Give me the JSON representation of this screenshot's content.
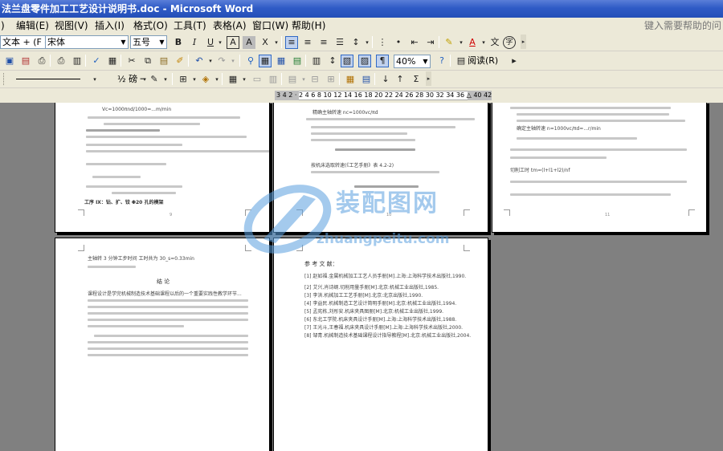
{
  "window": {
    "title": "法兰盘零件加工工艺设计说明书.doc - Microsoft Word"
  },
  "menubar": {
    "items": [
      "文件(F)",
      "编辑(E)",
      "视图(V)",
      "插入(I)",
      "格式(O)",
      "工具(T)",
      "表格(A)",
      "窗口(W)",
      "帮助(H)"
    ],
    "visible_items": [
      ")",
      "编辑(E)",
      "视图(V)",
      "插入(I)",
      "格式(O)",
      "工具(T)",
      "表格(A)",
      "窗口(W)",
      "帮助(H)"
    ],
    "help_placeholder": "键入需要帮助的问"
  },
  "formatting_toolbar": {
    "style_value": "文本 + (F -",
    "font_value": "宋体",
    "size_value": "五号",
    "bold_label": "B",
    "italic_label": "I",
    "underline_label": "U",
    "char_border_label": "A",
    "char_shading_label": "A",
    "scale_label": "X"
  },
  "standard_toolbar": {
    "zoom_value": "40%",
    "read_label": "阅读(R)"
  },
  "drawing_toolbar": {
    "style_label": "Σ"
  },
  "ruler": {
    "scale_text": "3 4 2 2 4 6 8 10 12 14 16 18 20 22 24 26 28 30 32 34 36 38 40 42",
    "visible_scale": "3 4 2 · 2 4 6 8 10 12 14 16 18 20 22 24 26 28 30 32 34 36 △ 40 42"
  },
  "document": {
    "pages": [
      {
        "id": "page-top-left",
        "number": "9"
      },
      {
        "id": "page-top-mid",
        "number": "10"
      },
      {
        "id": "page-top-right",
        "number": "11"
      },
      {
        "id": "page-bottom-left",
        "heading": "结 论",
        "first_line": "主轴转 3 分钟工步时间 工时共为 30_s=0.33min"
      },
      {
        "id": "page-bottom-mid",
        "heading": "参 考 文 献："
      }
    ],
    "snippets": {
      "p1_a": "Vc=1000πnd/1000=...m/min",
      "p1_b": "工序 Ⅸ：钻、扩、铰 Φ20 孔的模架",
      "p2_a": "精确主轴转速 nc=1000vc/πd",
      "p2_b": "按机床选取转速(《工艺手册》表 4.2-2)",
      "p3_a": "确定主轴转速 n=1000vc/πd=...r/min",
      "p3_b": "切削工时 tm=(l+l1+l2)/nf",
      "refs": [
        "[1] 赵如福.金属机械加工工艺人员手册[M].上海:上海科学技术出版社,1990.",
        "[2] 艾兴,肖诗纲.切削用量手册[M].北京:机械工业出版社,1985.",
        "[3] 李洪.机械加工工艺手册[M].北京:北京出版社,1990.",
        "[4] 李益民.机械制造工艺设计简明手册[M].北京:机械工业出版社,1994.",
        "[5] 孟宪栋,刘彤安.机床夹具图册[M].北京:机械工业出版社,1999.",
        "[6] 东北工学院.机床夹具设计手册[M].上海:上海科学技术出版社,1988.",
        "[7] 王光斗,王春福.机床夹具设计手册[M].上海:上海科学技术出版社,2000.",
        "[8] 邹青.机械制造技术基础课程设计指导教程[M].北京:机械工业出版社,2004."
      ],
      "conclusion": "课程设计是学完机械制造技术基础课程以后的一个重要实践性教学环节..."
    }
  },
  "watermark": {
    "brand_cn": "装配图网",
    "url": "zhuangpeitu.com",
    "color": "#5aa0e0"
  },
  "colors": {
    "titlebar": "#2f5bc6",
    "chrome": "#ece9d8",
    "workspace": "#808080"
  }
}
